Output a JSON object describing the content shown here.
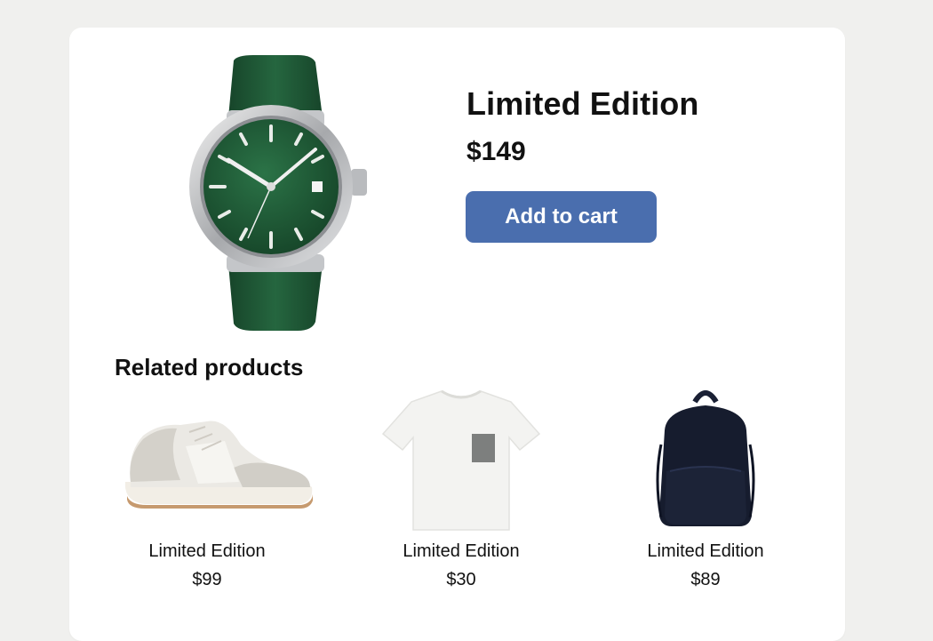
{
  "product": {
    "title": "Limited Edition",
    "price": "$149",
    "image_icon": "wristwatch-icon",
    "add_to_cart_label": "Add to cart"
  },
  "related": {
    "heading": "Related products",
    "items": [
      {
        "name": "Limited Edition",
        "price": "$99",
        "icon": "sneaker-icon"
      },
      {
        "name": "Limited Edition",
        "price": "$30",
        "icon": "tshirt-icon"
      },
      {
        "name": "Limited Edition",
        "price": "$89",
        "icon": "backpack-icon"
      }
    ]
  },
  "colors": {
    "page_background": "#f0f0ee",
    "card_background": "#ffffff",
    "button": "#4a6eae",
    "button_text": "#ffffff",
    "watch_green": "#1f5a36",
    "backpack_navy": "#161c2e"
  }
}
